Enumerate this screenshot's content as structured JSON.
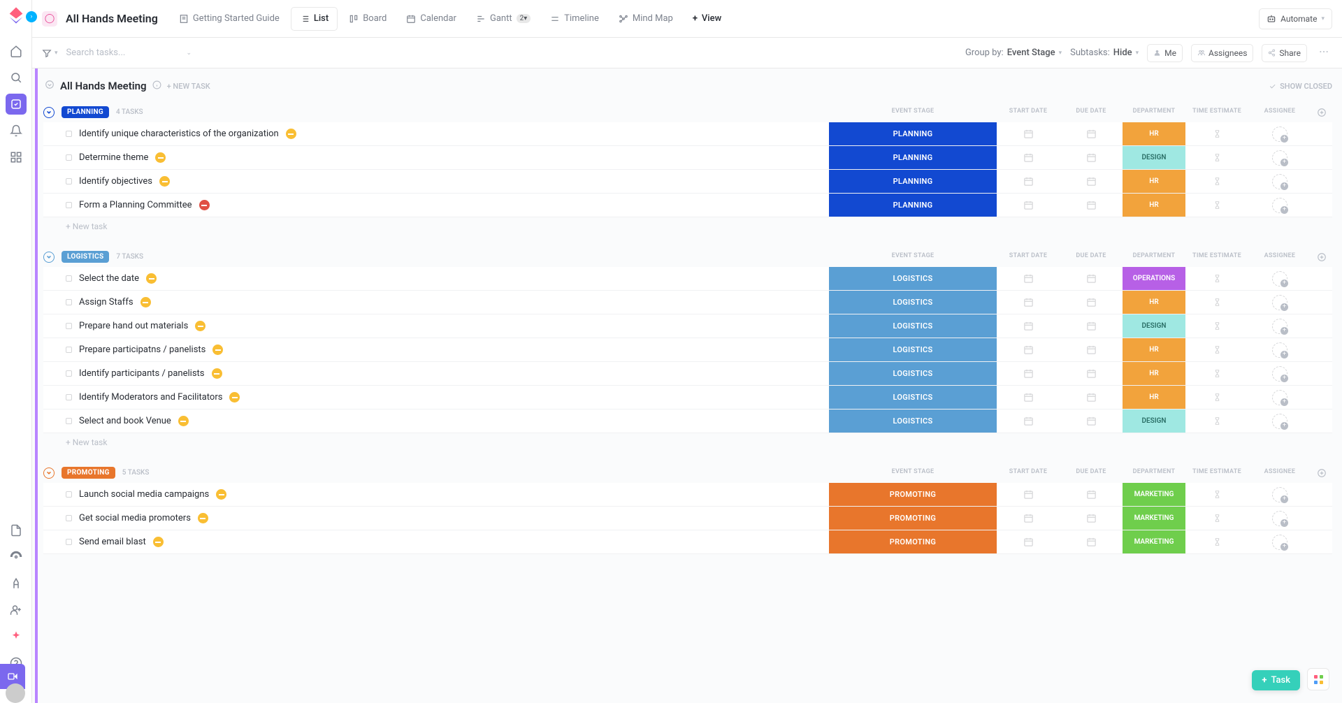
{
  "page_title": "All Hands Meeting",
  "views": {
    "guide": "Getting Started Guide",
    "list": "List",
    "board": "Board",
    "calendar": "Calendar",
    "gantt": "Gantt",
    "gantt_badge": "2▾",
    "timeline": "Timeline",
    "mindmap": "Mind Map",
    "view": "View"
  },
  "automate": "Automate",
  "filterbar": {
    "search_placeholder": "Search tasks...",
    "groupby_label": "Group by:",
    "groupby_value": "Event Stage",
    "subtasks_label": "Subtasks:",
    "subtasks_value": "Hide",
    "me": "Me",
    "assignees": "Assignees",
    "share": "Share"
  },
  "list_header": {
    "title": "All Hands Meeting",
    "new_task": "+ New task",
    "show_closed": "Show Closed"
  },
  "columns": {
    "stage": "Event Stage",
    "start": "Start Date",
    "due": "Due Date",
    "dept": "Department",
    "time": "Time Estimate",
    "assignee": "Assignee"
  },
  "new_task_row": "+ New task",
  "departments": {
    "hr": {
      "label": "HR",
      "bg": "#f2a33c"
    },
    "design": {
      "label": "DESIGN",
      "bg": "#9fe8e2"
    },
    "operations": {
      "label": "OPERATIONS",
      "bg": "#b760e6"
    },
    "marketing": {
      "label": "MARKETING",
      "bg": "#6fce4c"
    }
  },
  "stages": {
    "planning": {
      "label": "PLANNING",
      "bg": "#1249d1",
      "accent": "#1249d1"
    },
    "logistics": {
      "label": "LOGISTICS",
      "bg": "#5a9fd4",
      "accent": "#5a9fd4"
    },
    "promoting": {
      "label": "PROMOTING",
      "bg": "#e8762c",
      "accent": "#e8762c"
    }
  },
  "groups": [
    {
      "stage": "planning",
      "count": "4 Tasks",
      "tasks": [
        {
          "name": "Identify unique characteristics of the organization",
          "priority": "normal",
          "dept": "hr"
        },
        {
          "name": "Determine theme",
          "priority": "normal",
          "dept": "design"
        },
        {
          "name": "Identify objectives",
          "priority": "normal",
          "dept": "hr"
        },
        {
          "name": "Form a Planning Committee",
          "priority": "urgent",
          "dept": "hr"
        }
      ]
    },
    {
      "stage": "logistics",
      "count": "7 Tasks",
      "tasks": [
        {
          "name": "Select the date",
          "priority": "normal",
          "dept": "operations"
        },
        {
          "name": "Assign Staffs",
          "priority": "normal",
          "dept": "hr"
        },
        {
          "name": "Prepare hand out materials",
          "priority": "normal",
          "dept": "design"
        },
        {
          "name": "Prepare participatns / panelists",
          "priority": "normal",
          "dept": "hr"
        },
        {
          "name": "Identify participants / panelists",
          "priority": "normal",
          "dept": "hr"
        },
        {
          "name": "Identify Moderators and Facilitators",
          "priority": "normal",
          "dept": "hr"
        },
        {
          "name": "Select and book Venue",
          "priority": "normal",
          "dept": "design"
        }
      ]
    },
    {
      "stage": "promoting",
      "count": "5 Tasks",
      "tasks": [
        {
          "name": "Launch social media campaigns",
          "priority": "normal",
          "dept": "marketing"
        },
        {
          "name": "Get social media promoters",
          "priority": "normal",
          "dept": "marketing"
        },
        {
          "name": "Send email blast",
          "priority": "normal",
          "dept": "marketing"
        }
      ]
    }
  ],
  "float_task_label": "Task"
}
